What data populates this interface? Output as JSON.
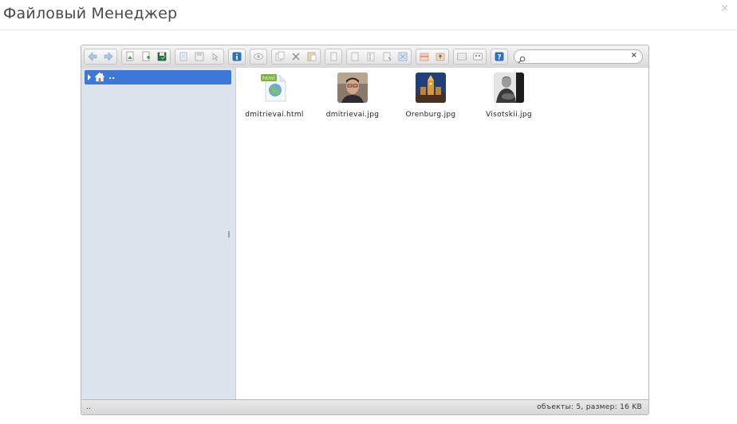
{
  "dialog": {
    "title": "Файловый Менеджер",
    "close_glyph": "×"
  },
  "toolbar": {
    "groups": [
      [
        "back-icon",
        "forward-icon"
      ],
      [
        "reload-icon",
        "new-file-icon",
        "save-icon"
      ],
      [
        "open-icon",
        "floppy-icon",
        "pointer-icon"
      ],
      [
        "info-icon"
      ],
      [
        "view-icon"
      ],
      [
        "copy-icon",
        "cut-icon",
        "paste-icon"
      ],
      [
        "duplicate-icon"
      ],
      [
        "rename-icon",
        "edit-icon",
        "extract-icon",
        "resize-icon"
      ],
      [
        "archive-icon",
        "unarchive-icon"
      ],
      [
        "icons-view-icon",
        "list-view-icon"
      ],
      [
        "help-icon"
      ]
    ],
    "search": {
      "placeholder": "",
      "value": "",
      "clear_glyph": "×"
    }
  },
  "tree": {
    "root_label": ".."
  },
  "files": [
    {
      "name": "dmitrievai.html",
      "type": "html",
      "badge": "html"
    },
    {
      "name": "dmitrievai.jpg",
      "type": "jpg"
    },
    {
      "name": "Orenburg.jpg",
      "type": "jpg"
    },
    {
      "name": "Visotskii.jpg",
      "type": "jpg"
    }
  ],
  "status": {
    "path": "..",
    "info": "объекты: 5, размер: 16 KB"
  },
  "colors": {
    "selection": "#3d78d8",
    "sidebar_bg": "#dce3ec",
    "toolbar_bg": "#e3e3e3"
  }
}
